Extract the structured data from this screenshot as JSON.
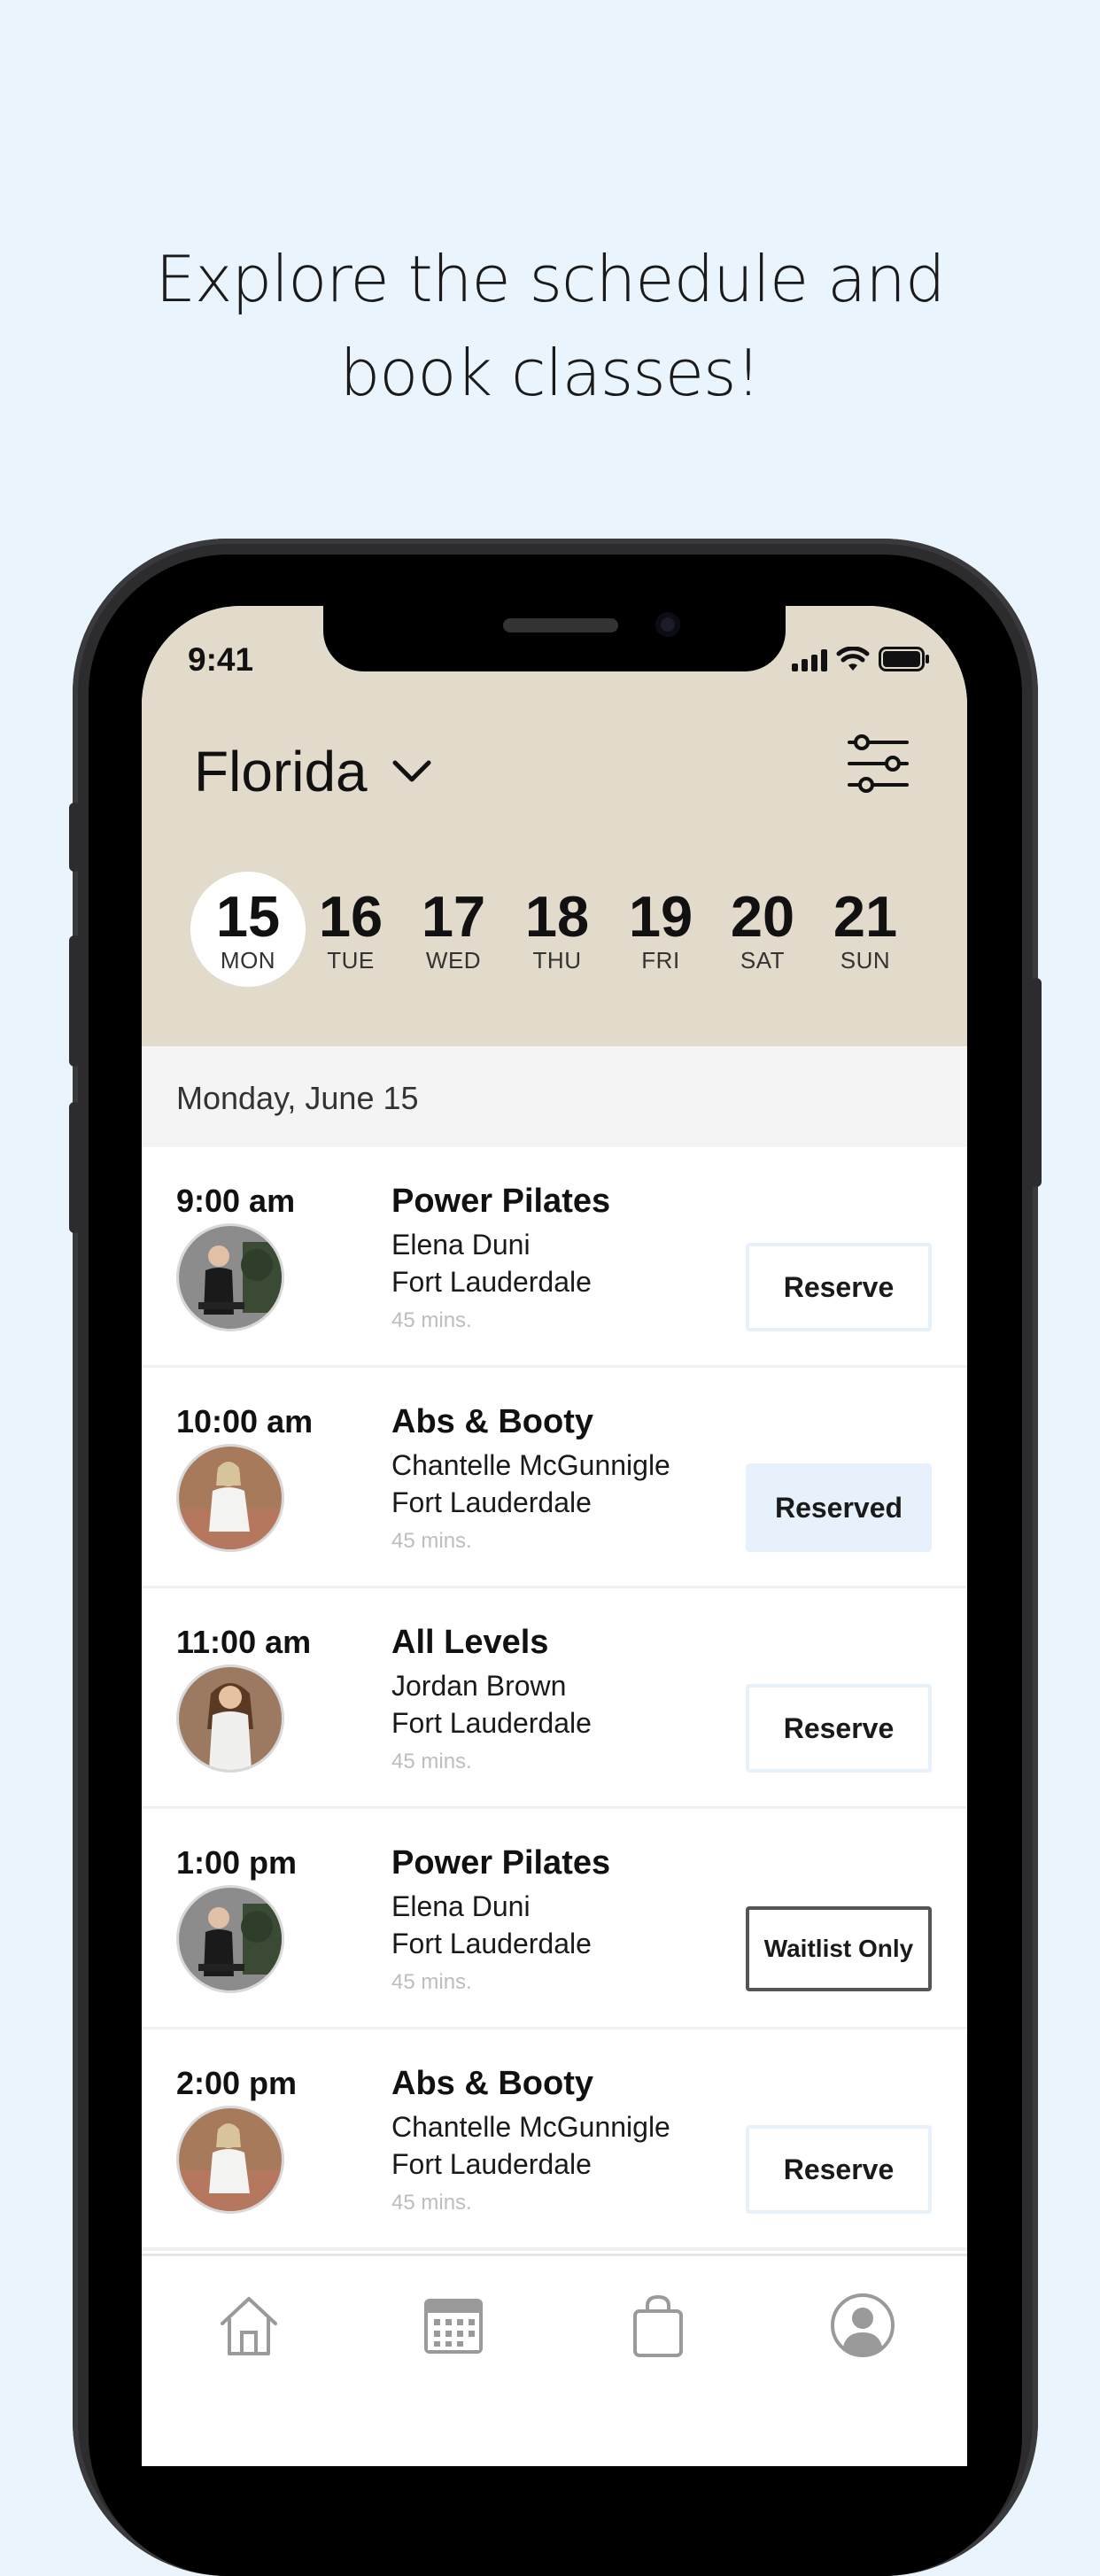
{
  "headline": {
    "line1": "Explore the schedule and",
    "line2": "book classes!"
  },
  "status_bar": {
    "time": "9:41"
  },
  "header": {
    "location": "Florida"
  },
  "days": [
    {
      "num": "15",
      "dow": "MON",
      "active": true
    },
    {
      "num": "16",
      "dow": "TUE"
    },
    {
      "num": "17",
      "dow": "WED"
    },
    {
      "num": "18",
      "dow": "THU"
    },
    {
      "num": "19",
      "dow": "FRI"
    },
    {
      "num": "20",
      "dow": "SAT"
    },
    {
      "num": "21",
      "dow": "SUN"
    }
  ],
  "selected_date": "Monday, June 15",
  "classes": [
    {
      "time": "9:00 am",
      "name": "Power Pilates",
      "instructor": "Elena Duni",
      "location": "Fort Lauderdale",
      "duration": "45 mins.",
      "action": "Reserve"
    },
    {
      "time": "10:00 am",
      "name": "Abs & Booty",
      "instructor": "Chantelle McGunnigle",
      "location": "Fort Lauderdale",
      "duration": "45 mins.",
      "action": "Reserved"
    },
    {
      "time": "11:00 am",
      "name": "All Levels",
      "instructor": "Jordan Brown",
      "location": "Fort Lauderdale",
      "duration": "45 mins.",
      "action": "Reserve"
    },
    {
      "time": "1:00 pm",
      "name": "Power Pilates",
      "instructor": "Elena Duni",
      "location": "Fort Lauderdale",
      "duration": "45 mins.",
      "action": "Waitlist Only"
    },
    {
      "time": "2:00 pm",
      "name": "Abs & Booty",
      "instructor": "Chantelle McGunnigle",
      "location": "Fort Lauderdale",
      "duration": "45 mins.",
      "action": "Reserve"
    }
  ],
  "tabbar": {
    "icons": [
      "home-icon",
      "calendar-icon",
      "shopping-bag-icon",
      "profile-icon"
    ]
  },
  "colors": {
    "background": "#eaf4fc",
    "header": "#e2dacb",
    "reserved_bg": "#e6f1fb"
  }
}
